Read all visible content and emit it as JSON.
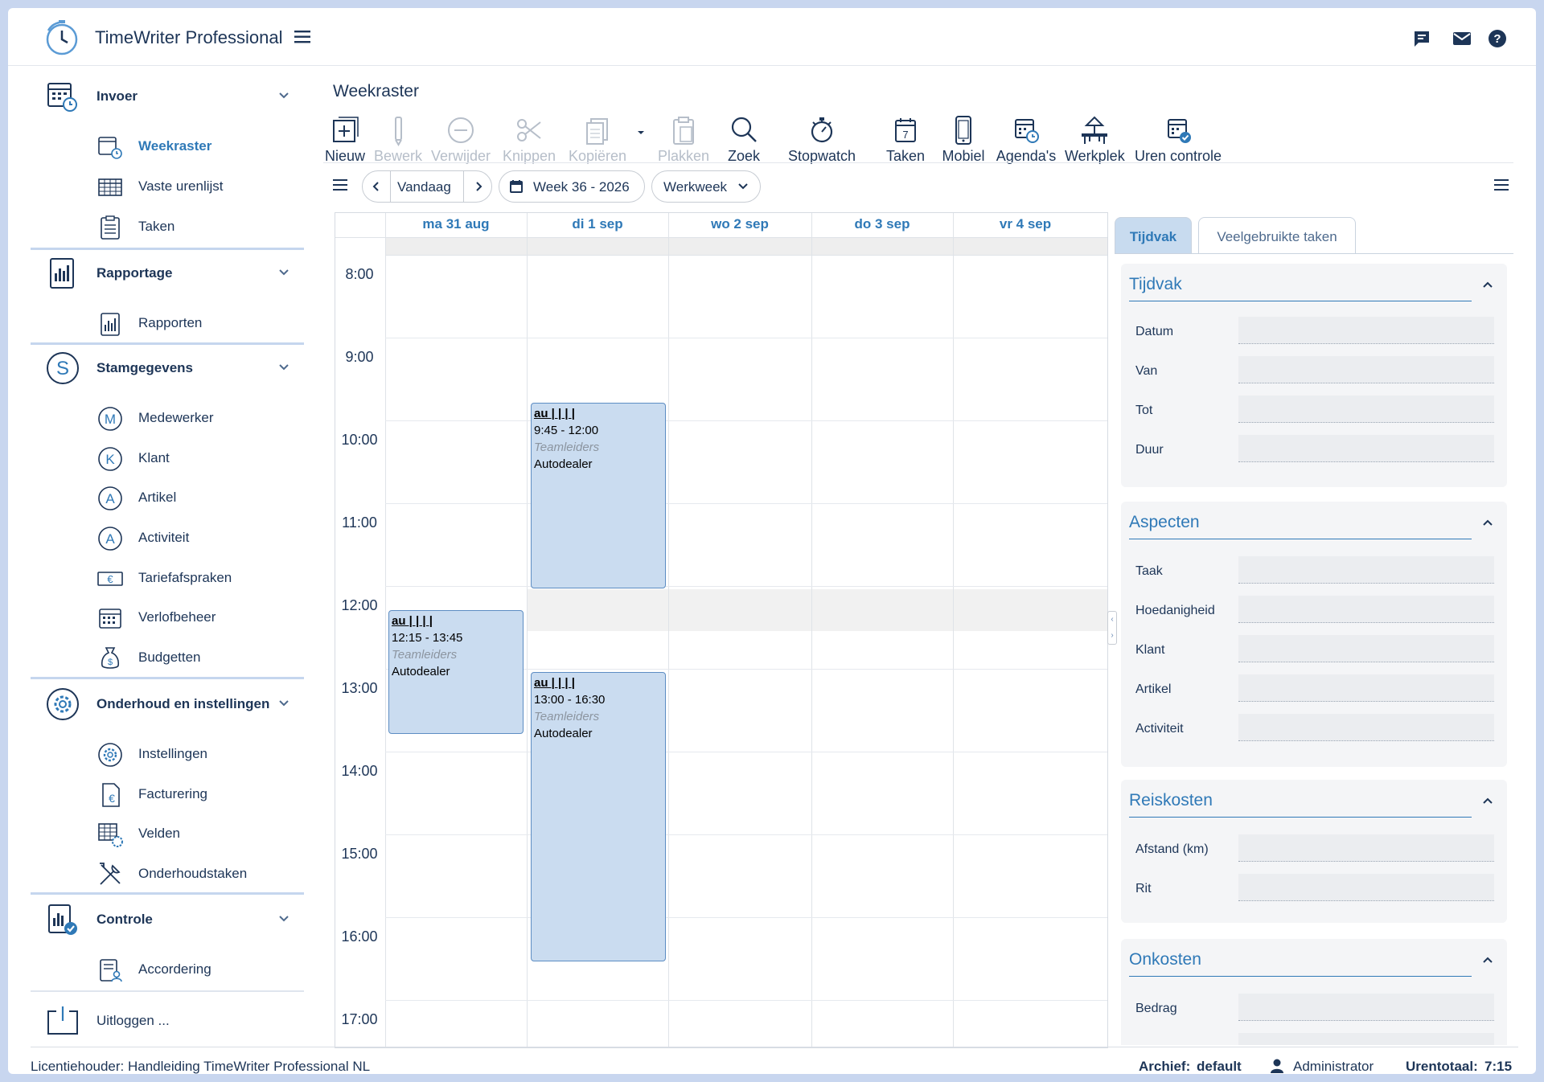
{
  "app": {
    "title": "TimeWriter Professional",
    "accent": "#2f79b7",
    "dark": "#1d3557",
    "background": "#c8d6ef"
  },
  "header_icons": [
    "chat-icon",
    "mail-icon",
    "help-icon"
  ],
  "sidebar": {
    "groups": [
      {
        "label": "Invoer",
        "icon": "calendar-clock-icon",
        "items": [
          {
            "label": "Weekraster",
            "icon": "calendar-clock-icon",
            "active": true
          },
          {
            "label": "Vaste urenlijst",
            "icon": "table-grid-icon"
          },
          {
            "label": "Taken",
            "icon": "clipboard-list-icon"
          }
        ]
      },
      {
        "label": "Rapportage",
        "icon": "report-chart-icon",
        "items": [
          {
            "label": "Rapporten",
            "icon": "report-chart-icon"
          }
        ]
      },
      {
        "label": "Stamgegevens",
        "icon": "letter-s-circle-icon",
        "items": [
          {
            "label": "Medewerker",
            "icon": "letter-m-circle-icon"
          },
          {
            "label": "Klant",
            "icon": "letter-k-circle-icon"
          },
          {
            "label": "Artikel",
            "icon": "letter-a-circle-icon"
          },
          {
            "label": "Activiteit",
            "icon": "letter-a-circle-icon"
          },
          {
            "label": "Tariefafspraken",
            "icon": "euro-banknote-icon"
          },
          {
            "label": "Verlofbeheer",
            "icon": "calendar-grid-icon"
          },
          {
            "label": "Budgetten",
            "icon": "money-bag-icon"
          }
        ]
      },
      {
        "label": "Onderhoud en instellingen",
        "icon": "gear-circle-icon",
        "items": [
          {
            "label": "Instellingen",
            "icon": "gear-circle-icon"
          },
          {
            "label": "Facturering",
            "icon": "euro-document-icon"
          },
          {
            "label": "Velden",
            "icon": "table-gear-icon"
          },
          {
            "label": "Onderhoudstaken",
            "icon": "wrench-screwdriver-icon"
          }
        ]
      },
      {
        "label": "Controle",
        "icon": "report-check-icon",
        "items": [
          {
            "label": "Accordering",
            "icon": "document-person-icon"
          }
        ]
      }
    ],
    "logout": "Uitloggen ..."
  },
  "page": {
    "title": "Weekraster"
  },
  "toolbar": {
    "nieuw": "Nieuw",
    "bewerk": "Bewerk",
    "verwijder": "Verwijder",
    "knippen": "Knippen",
    "kopieren": "Kopiëren",
    "plakken": "Plakken",
    "zoek": "Zoek",
    "stopwatch": "Stopwatch",
    "taken": "Taken",
    "mobiel": "Mobiel",
    "agendas": "Agenda's",
    "werkplek": "Werkplek",
    "uren_controle": "Uren controle"
  },
  "nav": {
    "today": "Vandaag",
    "week": "Week 36 - 2026",
    "view": "Werkweek"
  },
  "calendar": {
    "days": [
      "ma 31 aug",
      "di 1 sep",
      "wo 2 sep",
      "do 3 sep",
      "vr 4 sep"
    ],
    "hours": [
      "8:00",
      "9:00",
      "10:00",
      "11:00",
      "12:00",
      "13:00",
      "14:00",
      "15:00",
      "16:00",
      "17:00"
    ],
    "events": [
      {
        "code": "au | | | |",
        "time": "9:45 - 12:00",
        "group": "Teamleiders",
        "client": "Autodealer",
        "day": "di 1 sep"
      },
      {
        "code": "au | | | |",
        "time": "12:15 - 13:45",
        "group": "Teamleiders",
        "client": "Autodealer",
        "day": "ma 31 aug"
      },
      {
        "code": "au | | | |",
        "time": "13:00 - 16:30",
        "group": "Teamleiders",
        "client": "Autodealer",
        "day": "di 1 sep"
      }
    ]
  },
  "right_panel": {
    "tabs": [
      "Tijdvak",
      "Veelgebruikte taken"
    ],
    "sections": [
      {
        "title": "Tijdvak",
        "fields": [
          "Datum",
          "Van",
          "Tot",
          "Duur"
        ]
      },
      {
        "title": "Aspecten",
        "fields": [
          "Taak",
          "Hoedanigheid",
          "Klant",
          "Artikel",
          "Activiteit"
        ]
      },
      {
        "title": "Reiskosten",
        "fields": [
          "Afstand (km)",
          "Rit"
        ]
      },
      {
        "title": "Onkosten",
        "fields": [
          "Bedrag"
        ]
      }
    ]
  },
  "footer": {
    "license": "Licentiehouder: Handleiding TimeWriter Professional NL",
    "archive_label": "Archief:",
    "archive_value": "default",
    "user": "Administrator",
    "total_label": "Urentotaal:",
    "total_value": "7:15"
  }
}
